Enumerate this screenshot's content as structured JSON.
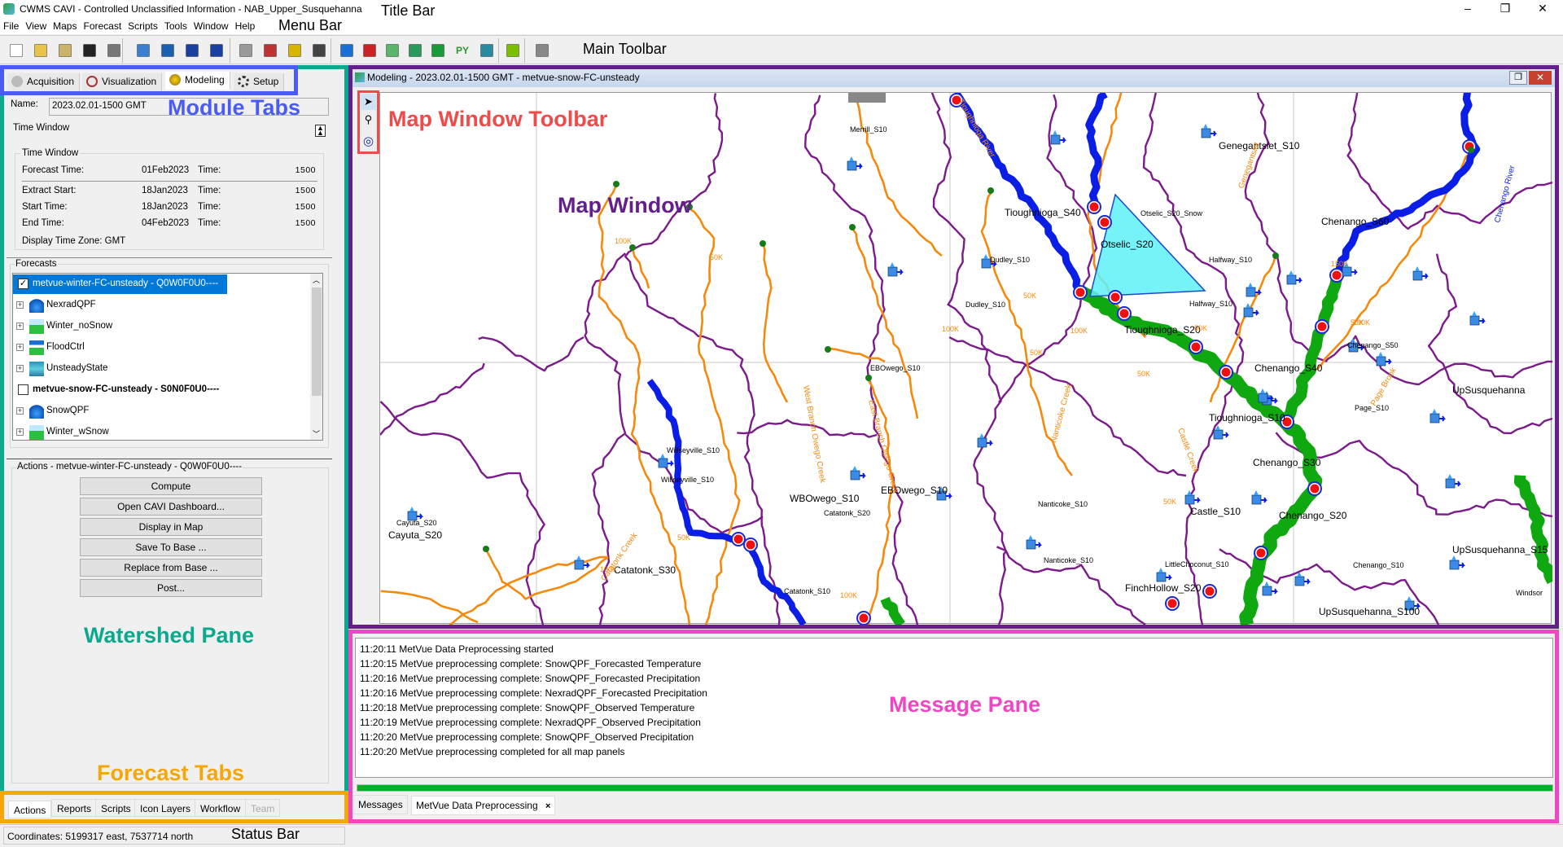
{
  "window": {
    "title": "CWMS CAVI - Controlled Unclassified Information - NAB_Upper_Susquehanna",
    "minimize": "–",
    "restore": "❐",
    "close": "✕"
  },
  "menu": [
    "File",
    "View",
    "Maps",
    "Forecast",
    "Scripts",
    "Tools",
    "Window",
    "Help"
  ],
  "toolbar": {
    "icons": [
      "new-file-icon",
      "open-folder-icon",
      "import-icon",
      "save-icon",
      "print-icon",
      "map-layers-icon",
      "forecast-manage-icon",
      "window-layout-icon",
      "cascade-windows-icon",
      "acquisition-icon",
      "visualization-icon",
      "modeling-icon",
      "setup-gear-icon",
      "precipitation-drop-icon",
      "grid-icon",
      "hms-icon",
      "ressim-icon",
      "ras-icon",
      "python-icon",
      "fia-icon",
      "hydrograph-icon",
      "more-arrow-icon"
    ],
    "python_label": "PY"
  },
  "annotations": {
    "title_bar": "Title Bar",
    "menu_bar": "Menu Bar",
    "main_toolbar": "Main Toolbar",
    "module_tabs": "Module Tabs",
    "map_window_toolbar": "Map Window Toolbar",
    "map_window": "Map Window",
    "watershed_pane": "Watershed Pane",
    "message_pane": "Message Pane",
    "forecast_tabs": "Forecast Tabs",
    "status_bar": "Status Bar"
  },
  "colors": {
    "module_tabs": "#4a5cf5",
    "map_toolbar": "#ef4b4b",
    "map_window": "#64208a",
    "watershed": "#0aa88c",
    "message": "#ef47c3",
    "forecast_tabs": "#f5a70a",
    "selection": "#0078d7",
    "progress": "#06b025"
  },
  "module_tabs": [
    {
      "label": "Acquisition",
      "icon": "satellite-icon"
    },
    {
      "label": "Visualization",
      "icon": "visualization-icon"
    },
    {
      "label": "Modeling",
      "icon": "modeling-icon",
      "selected": true
    },
    {
      "label": "Setup",
      "icon": "gear-icon"
    }
  ],
  "watershed": {
    "name_label": "Name:",
    "name_value": "2023.02.01-1500 GMT",
    "time_window_header": "Time Window",
    "time_window_group": "Time Window",
    "rows": [
      {
        "label": "Forecast Time:",
        "date": "01Feb2023",
        "time_label": "Time:",
        "time": "1500"
      },
      {
        "label": "Extract Start:",
        "date": "18Jan2023",
        "time_label": "Time:",
        "time": "1500"
      },
      {
        "label": "Start Time:",
        "date": "18Jan2023",
        "time_label": "Time:",
        "time": "1500"
      },
      {
        "label": "End Time:",
        "date": "04Feb2023",
        "time_label": "Time:",
        "time": "1500"
      }
    ],
    "display_tz": "Display Time Zone:  GMT",
    "forecasts_label": "Forecasts",
    "forecasts": [
      {
        "label": "metvue-winter-FC-unsteady - Q0W0F0U0----",
        "type": "run",
        "checked": true,
        "selected": true
      },
      {
        "label": "NexradQPF",
        "type": "child",
        "icon": "drop-icon"
      },
      {
        "label": "Winter_noSnow",
        "type": "child",
        "icon": "hms-icon"
      },
      {
        "label": "FloodCtrl",
        "type": "child",
        "icon": "ressim-icon"
      },
      {
        "label": "UnsteadyState",
        "type": "child",
        "icon": "ras-icon"
      },
      {
        "label": "metvue-snow-FC-unsteady  -  S0N0F0U0----",
        "type": "run",
        "checked": false
      },
      {
        "label": "SnowQPF",
        "type": "child",
        "icon": "drop-icon"
      },
      {
        "label": "Winter_wSnow",
        "type": "child",
        "icon": "hms-icon"
      }
    ],
    "actions_title": "Actions - metvue-winter-FC-unsteady - Q0W0F0U0----",
    "actions": [
      "Compute",
      "Open CAVI Dashboard...",
      "Display in Map",
      "Save To Base ...",
      "Replace from Base ...",
      "Post..."
    ]
  },
  "forecast_tabs": [
    {
      "label": "Actions",
      "selected": true
    },
    {
      "label": "Reports"
    },
    {
      "label": "Scripts"
    },
    {
      "label": "Icon Layers"
    },
    {
      "label": "Workflow"
    },
    {
      "label": "Team",
      "disabled": true
    }
  ],
  "map": {
    "title": "Modeling - 2023.02.01-1500 GMT - metvue-snow-FC-unsteady",
    "tools": [
      "select-arrow-icon",
      "zoom-magnifier-icon",
      "hydrograph-tool-icon"
    ],
    "labels": [
      "Genegantslet_S10",
      "Tioughnioga_S40",
      "Otselic_S20",
      "Otselic_S20_Snow",
      "Chenango_S60",
      "Dudley_S10",
      "Dudley_S10",
      "Halfway_S10",
      "Halfway_S10",
      "Tioughnioga_S20",
      "Chenango_S40",
      "EBOwego_S10",
      "Tioughnioga_S10",
      "Page_S10",
      "UpSusquehanna",
      "Chenango_S30",
      "Chenango_S20",
      "Castle_S10",
      "WBOwego_S10",
      "EBOwego_S10",
      "Cayuta_S20",
      "Cayuta_S20",
      "Willseyville_S10",
      "Willseyville_S10",
      "Catatonk_S30",
      "Catatonk_S20",
      "Catatonk_S10",
      "Nanticoke_S10",
      "Nanticoke_S10",
      "FinchHollow_S20",
      "LittleChoconut_S10",
      "UpSusquehanna_S100",
      "UpSusquehanna_S15",
      "Chenango_S50",
      "Chenango_S10",
      "Merrill_S10",
      "Windsor"
    ],
    "stream_labels": [
      "100K",
      "50K",
      "100K",
      "100K",
      "50K",
      "150K",
      "50K",
      "100K",
      "50K",
      "50K",
      "100K",
      "50K",
      "50K",
      "100K",
      "50K"
    ],
    "river_names": [
      "Chenango River",
      "Tioughnioga River",
      "West Branch Owego Creek",
      "East Branch Owego Creek",
      "Catatonk Creek",
      "Nanticoke Creek",
      "Castle Creek",
      "Page Brook",
      "Genegantslet"
    ]
  },
  "messages": {
    "lines": [
      "11:20:11 MetVue Data Preprocessing started",
      "11:20:15 MetVue preprocessing complete: SnowQPF_Forecasted Temperature",
      "11:20:16 MetVue preprocessing complete: SnowQPF_Forecasted Precipitation",
      "11:20:16 MetVue preprocessing complete: NexradQPF_Forecasted Precipitation",
      "11:20:18 MetVue preprocessing complete: SnowQPF_Observed Temperature",
      "11:20:19 MetVue preprocessing complete: NexradQPF_Observed Precipitation",
      "11:20:20 MetVue preprocessing complete: SnowQPF_Observed Precipitation",
      "11:20:20 MetVue preprocessing completed for all map panels"
    ],
    "progress_percent": 100,
    "tabs": [
      {
        "label": "Messages"
      },
      {
        "label": "MetVue Data Preprocessing",
        "selected": true,
        "close": "×"
      }
    ]
  },
  "status": {
    "coordinates": "Coordinates: 5199317 east, 7537714 north"
  }
}
